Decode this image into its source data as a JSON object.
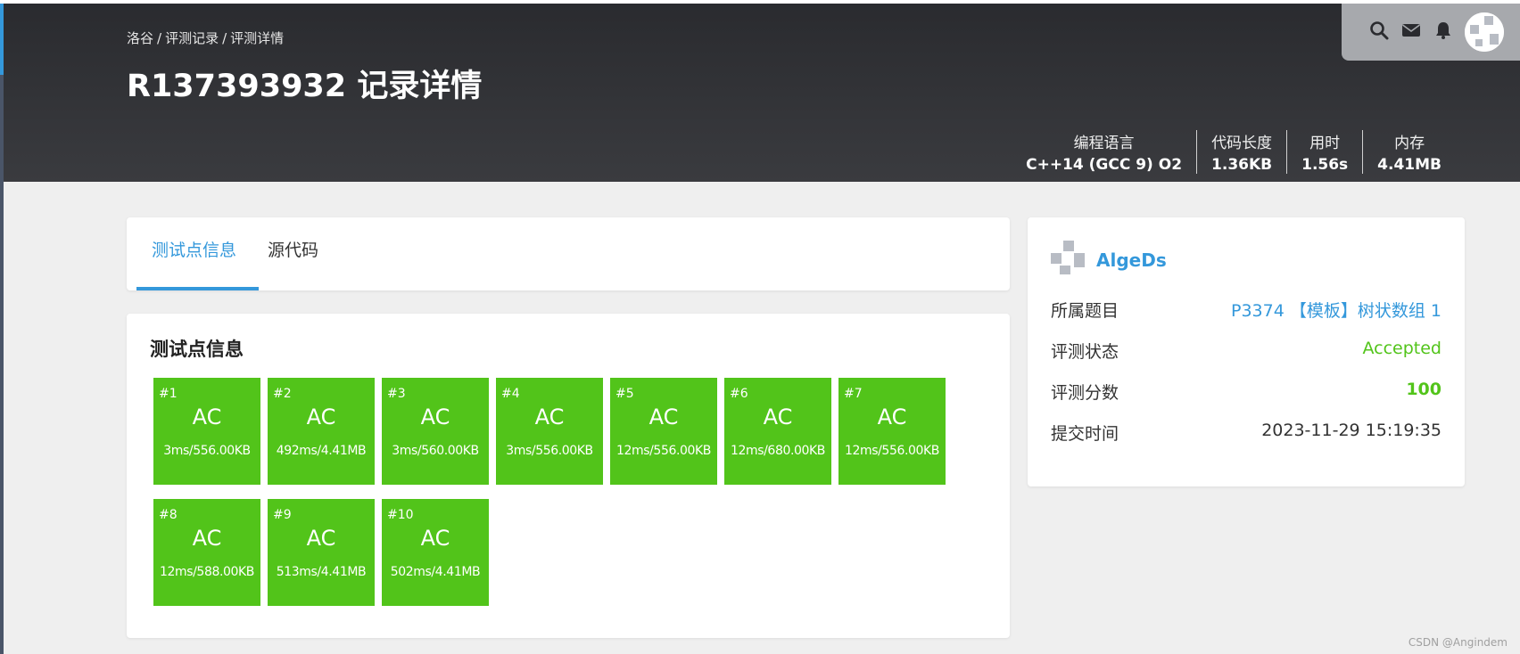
{
  "colors": {
    "accent": "#3498db",
    "success": "#52c41a",
    "header_bg": "#2f3034",
    "page_bg": "#efefef"
  },
  "header": {
    "breadcrumb": [
      "洛谷",
      "评测记录",
      "评测详情"
    ],
    "title": "R137393932 记录详情",
    "stats": [
      {
        "label": "编程语言",
        "value": "C++14 (GCC 9) O2"
      },
      {
        "label": "代码长度",
        "value": "1.36KB"
      },
      {
        "label": "用时",
        "value": "1.56s"
      },
      {
        "label": "内存",
        "value": "4.41MB"
      }
    ],
    "icons": [
      "search-icon",
      "mail-icon",
      "bell-icon",
      "avatar"
    ]
  },
  "tabs": [
    {
      "label": "测试点信息",
      "active": true
    },
    {
      "label": "源代码",
      "active": false
    }
  ],
  "testcases": {
    "title": "测试点信息",
    "items": [
      {
        "no": "#1",
        "result": "AC",
        "info": "3ms/556.00KB"
      },
      {
        "no": "#2",
        "result": "AC",
        "info": "492ms/4.41MB"
      },
      {
        "no": "#3",
        "result": "AC",
        "info": "3ms/560.00KB"
      },
      {
        "no": "#4",
        "result": "AC",
        "info": "3ms/556.00KB"
      },
      {
        "no": "#5",
        "result": "AC",
        "info": "12ms/556.00KB"
      },
      {
        "no": "#6",
        "result": "AC",
        "info": "12ms/680.00KB"
      },
      {
        "no": "#7",
        "result": "AC",
        "info": "12ms/556.00KB"
      },
      {
        "no": "#8",
        "result": "AC",
        "info": "12ms/588.00KB"
      },
      {
        "no": "#9",
        "result": "AC",
        "info": "513ms/4.41MB"
      },
      {
        "no": "#10",
        "result": "AC",
        "info": "502ms/4.41MB"
      }
    ]
  },
  "side": {
    "username": "AlgeDs",
    "rows": [
      {
        "label": "所属题目",
        "value": "P3374 【模板】树状数组 1"
      },
      {
        "label": "评测状态",
        "value": "Accepted"
      },
      {
        "label": "评测分数",
        "value": "100"
      },
      {
        "label": "提交时间",
        "value": "2023-11-29 15:19:35"
      }
    ]
  },
  "watermark": "CSDN @Angindem"
}
